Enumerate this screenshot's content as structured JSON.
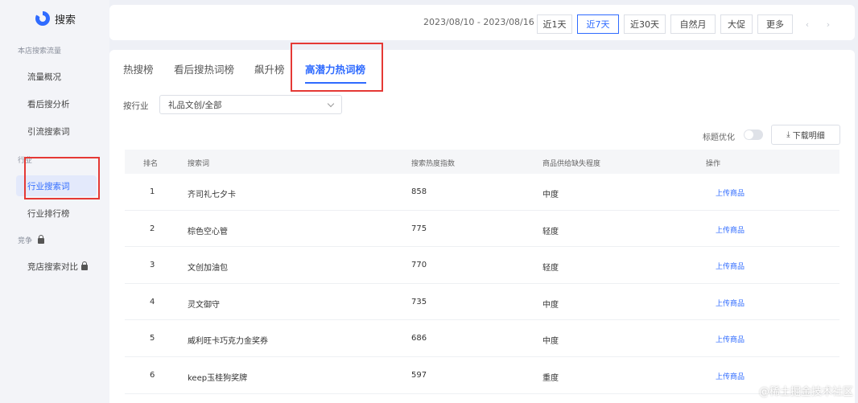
{
  "sidebar": {
    "title": "搜索",
    "group_store": "本店搜索流量",
    "items_store": [
      "流量概况",
      "看后搜分析",
      "引流搜索词"
    ],
    "group_industry": "行业",
    "items_industry": [
      "行业搜索词",
      "行业排行榜"
    ],
    "group_compete": "竞争",
    "items_compete": [
      "竞店搜索对比"
    ]
  },
  "topbar": {
    "date_range": "2023/08/10 - 2023/08/16",
    "ranges": [
      "近1天",
      "近7天",
      "近30天",
      "自然月",
      "大促",
      "更多"
    ],
    "active_range": "近7天",
    "prev_arrow": "‹",
    "next_arrow": "›"
  },
  "tabs": [
    "热搜榜",
    "看后搜热词榜",
    "飙升榜",
    "高潜力热词榜"
  ],
  "active_tab": "高潜力热词榜",
  "filter": {
    "label": "按行业",
    "value": "礼品文创/全部"
  },
  "toolbar": {
    "optimize_label": "标题优化",
    "download_label": "下载明细",
    "download_icon": "⤓"
  },
  "table": {
    "headers": [
      "排名",
      "搜索词",
      "搜索热度指数",
      "商品供给缺失程度",
      "操作"
    ],
    "rows": [
      {
        "rank": "1",
        "term": "齐司礼七夕卡",
        "heat": "858",
        "gap": "中度",
        "action": "上传商品"
      },
      {
        "rank": "2",
        "term": "棕色空心管",
        "heat": "775",
        "gap": "轻度",
        "action": "上传商品"
      },
      {
        "rank": "3",
        "term": "文创加油包",
        "heat": "770",
        "gap": "轻度",
        "action": "上传商品"
      },
      {
        "rank": "4",
        "term": "灵文御守",
        "heat": "735",
        "gap": "中度",
        "action": "上传商品"
      },
      {
        "rank": "5",
        "term": "威利旺卡巧克力金奖券",
        "heat": "686",
        "gap": "中度",
        "action": "上传商品"
      },
      {
        "rank": "6",
        "term": "keep玉桂狗奖牌",
        "heat": "597",
        "gap": "重度",
        "action": "上传商品"
      }
    ]
  },
  "watermark": "@稀土掘金技术社区",
  "colors": {
    "accent": "#2f6bff",
    "highlight_box": "#e53935"
  }
}
